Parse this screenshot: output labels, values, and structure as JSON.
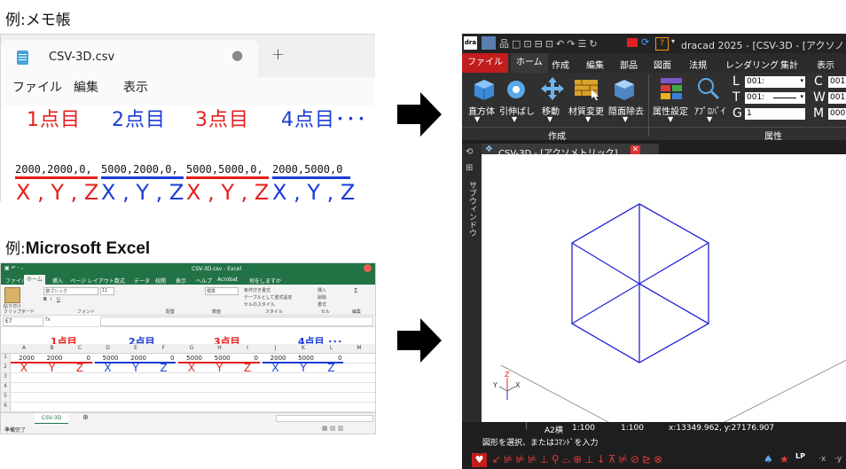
{
  "captions": {
    "notepad": "例:メモ帳",
    "excel_prefix": "例:",
    "excel_name": "Microsoft Excel"
  },
  "notepad": {
    "tab_title": "CSV-3D.csv",
    "tab_dot": "●",
    "new_tab": "+",
    "menu": [
      "ファイル",
      "編集",
      "表示"
    ],
    "points": [
      "1点目",
      "2点目",
      "3点目",
      "4点目･･･"
    ],
    "coords": [
      "2000,2000,0,",
      "5000,2000,0,",
      "5000,5000,0,",
      "2000,5000,0"
    ],
    "xyz": [
      "X , Y , Z",
      "X , Y , Z",
      "X , Y , Z",
      "X , Y , Z"
    ]
  },
  "excel": {
    "title": "CSV-3D.csv - Excel",
    "ribbon_tabs": [
      "ファイル",
      "ホーム",
      "挿入",
      "ページ レイアウト",
      "数式",
      "データ",
      "校閲",
      "表示",
      "ヘルプ",
      "Acrobat",
      "何をしますか"
    ],
    "namebox": "E7",
    "col_headers": [
      "A",
      "B",
      "C",
      "D",
      "E",
      "F",
      "G",
      "H",
      "I",
      "J",
      "K",
      "L",
      "M"
    ],
    "row_numbers": [
      "1",
      "2",
      "3",
      "4",
      "5",
      "6"
    ],
    "row1": [
      "2000",
      "2000",
      "0",
      "5000",
      "2000",
      "0",
      "5000",
      "5000",
      "0",
      "2000",
      "5000",
      "0"
    ],
    "row2": [
      "X",
      "Y",
      "Z",
      "X",
      "Y",
      "Z",
      "X",
      "Y",
      "Z",
      "X",
      "Y",
      "Z"
    ],
    "points": [
      "1点目",
      "2点目",
      "3点目",
      "4点目 ･･･"
    ],
    "sheet_tab": "CSV-3D",
    "status": "準備完了",
    "groups": [
      "クリップボード",
      "フォント",
      "配置",
      "数値",
      "スタイル",
      "セル",
      "編集"
    ],
    "font_name": "游ゴシック",
    "font_size": "11",
    "number_format": "標準",
    "style_items": [
      "条件付き書式",
      "テーブルとして書式設定",
      "セルのスタイル"
    ],
    "cell_items": [
      "挿入",
      "削除",
      "書式"
    ],
    "paste_label": "貼り付け"
  },
  "cad": {
    "title": "dracad 2025 - [CSV-3D - [アクソノ",
    "menu": [
      "ファイル",
      "ホーム",
      "作成",
      "編集",
      "部品",
      "図面",
      "法規",
      "レンダリング",
      "集計",
      "表示"
    ],
    "ribbon_buttons": [
      "直方体",
      "引伸ばし",
      "移動",
      "材質変更",
      "隠面除去",
      "属性設定",
      "ｱﾌﾟﾛﾊﾟｲ"
    ],
    "group_labels": [
      "作成",
      "属性"
    ],
    "layer_L": "001:",
    "layer_T": "001:",
    "layer_G": "1",
    "right_C": "001",
    "right_W": "001",
    "right_M": "000",
    "prop_letters": [
      "L",
      "T",
      "G",
      "C",
      "W",
      "M"
    ],
    "view_tab": "CSV-3D - [アクソメトリック]",
    "side_label": "サブウィンドウ",
    "status_sheet": "A2横",
    "status_scale1": "1:100",
    "status_scale2": "1:100",
    "status_coord": "x:13349.962, y:27176.907",
    "prompt": "図形を選択、またはｺﾏﾝﾄﾞを入力"
  },
  "colors": {
    "red": "#e61e1e",
    "blue": "#1a3cd6",
    "excel_green": "#217346",
    "cad_red": "#c21d1d"
  }
}
